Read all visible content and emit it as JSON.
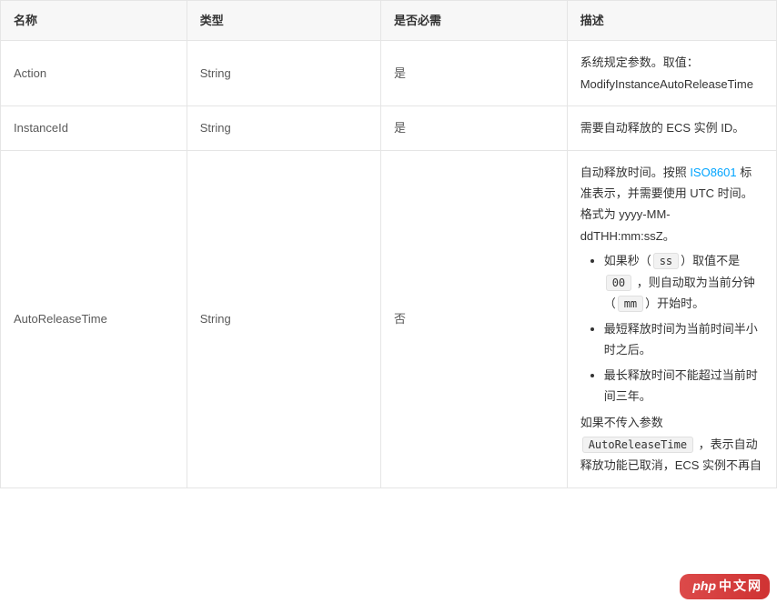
{
  "headers": {
    "name": "名称",
    "type": "类型",
    "required": "是否必需",
    "description": "描述"
  },
  "rows": [
    {
      "name": "Action",
      "type": "String",
      "required": "是",
      "desc_plain": "系统规定参数。取值：ModifyInstanceAutoReleaseTime"
    },
    {
      "name": "InstanceId",
      "type": "String",
      "required": "是",
      "desc_plain": "需要自动释放的 ECS 实例 ID。"
    },
    {
      "name": "AutoReleaseTime",
      "type": "String",
      "required": "否",
      "desc": {
        "intro_before_link": "自动释放时间。按照 ",
        "link_text": "ISO8601",
        "intro_after_link": " 标准表示，并需要使用 UTC 时间。格式为 yyyy-MM-ddTHH:mm:ssZ。",
        "bullets": [
          {
            "t1": "如果秒（",
            "c1": "ss",
            "t2": "）取值不是 ",
            "c2": "00",
            "t3": " ，则自动取为当前分钟（",
            "c3": "mm",
            "t4": "）开始时。"
          },
          {
            "plain": "最短释放时间为当前时间半小时之后。"
          },
          {
            "plain": "最长释放时间不能超过当前时间三年。"
          }
        ],
        "tail_before": "如果不传入参数 ",
        "tail_code": "AutoReleaseTime",
        "tail_after": " ，表示自动释放功能已取消，ECS 实例不再自"
      }
    }
  ],
  "watermark": {
    "prefix": "php",
    "text": "中文网"
  }
}
